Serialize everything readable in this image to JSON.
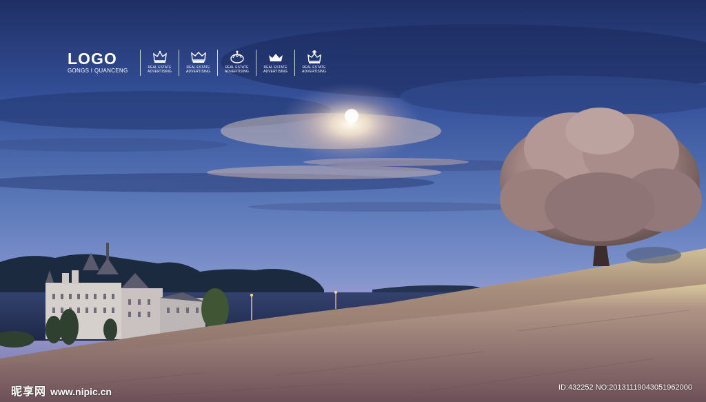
{
  "logo": {
    "title": "LOGO",
    "subtitle": "GONGS I QUANCENG"
  },
  "badges": [
    {
      "icon": "crown-icon",
      "label_line1": "REAL ESTATE",
      "label_line2": "ADVERTISING"
    },
    {
      "icon": "crown-icon",
      "label_line1": "REAL ESTATE",
      "label_line2": "ADVERTISING"
    },
    {
      "icon": "crown-icon",
      "label_line1": "REAL ESTATE",
      "label_line2": "ADVERTISING"
    },
    {
      "icon": "crown-icon",
      "label_line1": "REAL ESTATE",
      "label_line2": "ADVERTISING"
    },
    {
      "icon": "crown-icon",
      "label_line1": "REAL ESTATE",
      "label_line2": "ADVERTISING"
    }
  ],
  "watermark": {
    "brand": "昵享网",
    "url": "www.nipic.cn",
    "id_text": "ID:432252 NO:20131119043051962000"
  },
  "colors": {
    "sky_top": "#24366e",
    "sky_mid": "#5b78b5",
    "horizon": "#8a9ad0",
    "meadow": "#9a8478",
    "tree_foliage": "#a88b88",
    "moon_glow": "#fff2d8"
  }
}
